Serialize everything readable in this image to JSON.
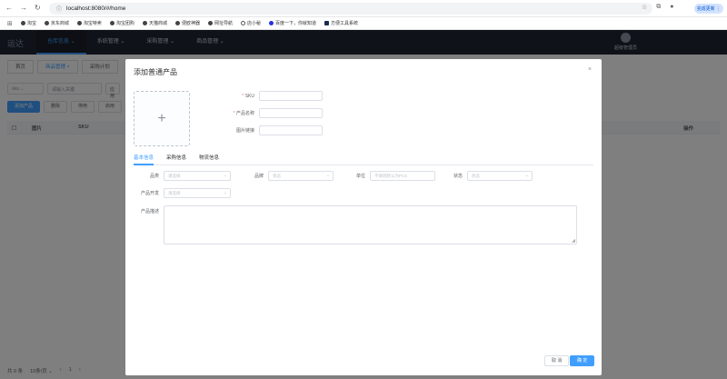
{
  "browser": {
    "url": "localhost:8080/#/home",
    "update_label": "完成更新 ⋮",
    "bookmarks": [
      "淘宝",
      "京东商城",
      "淘宝特卖",
      "淘宝团购",
      "天猫商城",
      "便欧神器",
      "网址导航",
      "店小秘",
      "百度一下，你就知道",
      "方便工具系统"
    ]
  },
  "app": {
    "logo": "运达",
    "menu": [
      "仓库信息 ⌄",
      "系统管理 ⌄",
      "采购管理 ⌄",
      "商品管理 ⌄"
    ],
    "user": "超级管理员"
  },
  "background": {
    "tabs": [
      "首页",
      "商品管理 ×",
      "采购计划"
    ],
    "filters": {
      "sku": "sku ⌄",
      "search_placeholder": "请输入关键",
      "apply": "应用"
    },
    "buttons": [
      "添加产品",
      "删除",
      "停用",
      "启用"
    ],
    "table_headers": {
      "image": "图片",
      "sku": "SKU",
      "actions": "操作"
    },
    "pager": {
      "total": "共 0 条",
      "page_size": "10条/页 ⌄",
      "prev": "‹",
      "page": "1",
      "next": "›"
    }
  },
  "dialog": {
    "title": "添加普通产品",
    "close": "×",
    "upload_plus": "+",
    "fields": {
      "sku": "SKU",
      "name": "产品名称",
      "image_link": "图片链接"
    },
    "tabs": [
      "基本信息",
      "采购信息",
      "物流信息"
    ],
    "basic": {
      "category_label": "品类",
      "category_placeholder": "请选择",
      "brand_label": "品牌",
      "brand_placeholder": "状态",
      "unit_label": "单位",
      "unit_placeholder": "不填则默认为PCS",
      "status_label": "状态",
      "status_placeholder": "状态",
      "developer_label": "产品开发",
      "developer_placeholder": "请选择",
      "desc_label": "产品描述"
    },
    "cancel": "取 消",
    "ok": "确 定"
  },
  "colors": {
    "primary": "#409eff",
    "nav_bg": "#1e2431",
    "overlay": "rgba(0,0,0,0.5)"
  }
}
